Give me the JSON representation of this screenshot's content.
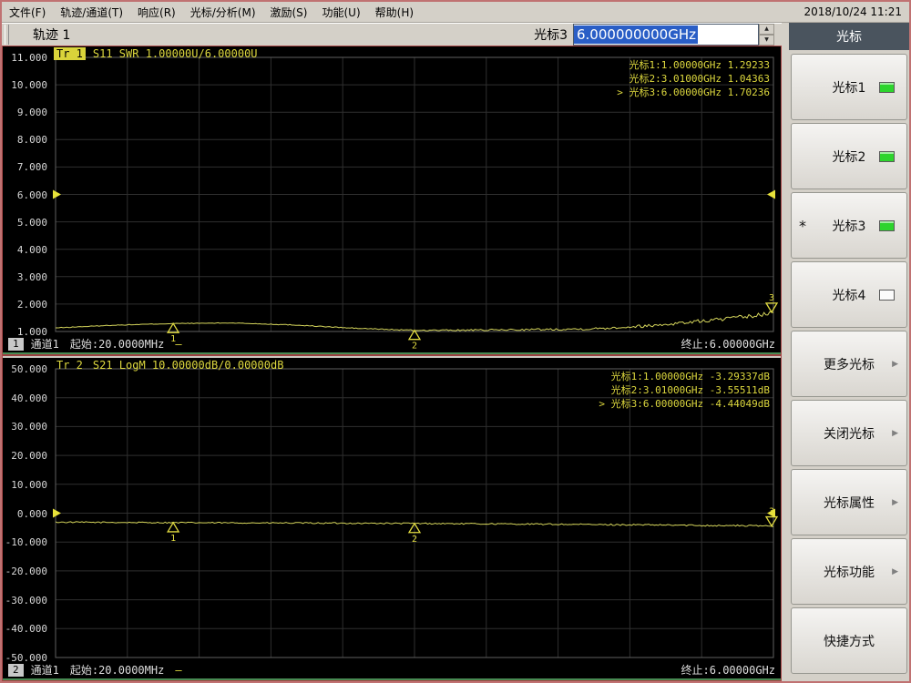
{
  "window": {
    "date_time": "2018/10/24 11:21"
  },
  "menu": {
    "items": [
      {
        "name": "file",
        "label": "文件(F)"
      },
      {
        "name": "trace-channel",
        "label": "轨迹/通道(T)"
      },
      {
        "name": "response",
        "label": "响应(R)"
      },
      {
        "name": "marker-analysis",
        "label": "光标/分析(M)"
      },
      {
        "name": "stimulus",
        "label": "激励(S)"
      },
      {
        "name": "utility",
        "label": "功能(U)"
      },
      {
        "name": "help",
        "label": "帮助(H)"
      }
    ]
  },
  "toolbar": {
    "trace_label": "轨迹 1",
    "marker_field_label": "光标3",
    "marker_field_value": "6.000000000GHz",
    "spin_up": "▲",
    "spin_down": "▼"
  },
  "sidebar": {
    "header": "光标",
    "buttons": [
      {
        "name": "marker1",
        "label": "光标1",
        "led": "on"
      },
      {
        "name": "marker2",
        "label": "光标2",
        "led": "on"
      },
      {
        "name": "marker3",
        "label": "光标3",
        "led": "on",
        "star": "*"
      },
      {
        "name": "marker4",
        "label": "光标4",
        "led": "off"
      },
      {
        "name": "more-markers",
        "label": "更多光标",
        "arrow": true
      },
      {
        "name": "markers-off",
        "label": "关闭光标",
        "arrow": true
      },
      {
        "name": "marker-properties",
        "label": "光标属性",
        "arrow": true
      },
      {
        "name": "marker-function",
        "label": "光标功能",
        "arrow": true
      },
      {
        "name": "shortcuts",
        "label": "快捷方式"
      }
    ]
  },
  "colors": {
    "grid": "#2f2f2f",
    "plot_border": "#5f5f5f",
    "trace": "#d6d65c",
    "marker": "#e2dc40",
    "marker_text": "#ddd83e",
    "ref_arrow": "#e8e23a",
    "axis_text": "#d8d8d8",
    "selection_bg": "#2a5ec6",
    "led_on": "#2dd42d",
    "sidebar_header_bg": "#4a545e",
    "window_border": "#c07272",
    "panel_bottom_line": "#478a52"
  },
  "charts": [
    {
      "tr_tag": "Tr 1",
      "tr_highlight": true,
      "title": "S11 SWR 1.00000U/6.00000U",
      "y_axis": {
        "labels": [
          "11.000",
          "10.000",
          "9.000",
          "8.000",
          "7.000",
          "6.000",
          "5.000",
          "4.000",
          "3.000",
          "2.000",
          "1.000"
        ],
        "min": 1,
        "max": 11,
        "ref_value": 6
      },
      "x_axis": {
        "start_ghz": 0.02,
        "stop_ghz": 6.0,
        "divisions": 10
      },
      "markers": [
        {
          "n": "1",
          "line": "光标1:1.00000GHz 1.29233",
          "freq_ghz": 1.0,
          "value": 1.29233,
          "active": false
        },
        {
          "n": "2",
          "line": "光标2:3.01000GHz 1.04363",
          "freq_ghz": 3.01,
          "value": 1.04363,
          "active": false
        },
        {
          "n": "3",
          "line": "> 光标3:6.00000GHz 1.70236",
          "freq_ghz": 6.0,
          "value": 1.70236,
          "active": true
        }
      ],
      "trace": {
        "anchor_ghz": [
          0.02,
          0.5,
          1.0,
          1.5,
          2.0,
          2.5,
          3.01,
          3.5,
          4.0,
          4.5,
          5.0,
          5.4,
          5.7,
          5.9,
          6.0
        ],
        "anchor_val": [
          1.13,
          1.23,
          1.29,
          1.31,
          1.24,
          1.12,
          1.04,
          1.05,
          1.07,
          1.1,
          1.22,
          1.38,
          1.5,
          1.6,
          1.7
        ],
        "noise": 0.012,
        "noise_end": 0.09,
        "seed": 13
      },
      "status": {
        "badge": "1",
        "channel": "通道1",
        "start": "起始:20.0000MHz",
        "sweep": "—",
        "stop": "终止:6.00000GHz"
      }
    },
    {
      "tr_tag": "Tr 2",
      "tr_highlight": false,
      "title": "S21 LogM 10.00000dB/0.00000dB",
      "y_axis": {
        "labels": [
          "50.000",
          "40.000",
          "30.000",
          "20.000",
          "10.000",
          "0.000",
          "-10.000",
          "-20.000",
          "-30.000",
          "-40.000",
          "-50.000"
        ],
        "min": -50,
        "max": 50,
        "ref_value": 0
      },
      "x_axis": {
        "start_ghz": 0.02,
        "stop_ghz": 6.0,
        "divisions": 10
      },
      "markers": [
        {
          "n": "1",
          "line": "光标1:1.00000GHz -3.29337dB",
          "freq_ghz": 1.0,
          "value": -3.29337,
          "active": false
        },
        {
          "n": "2",
          "line": "光标2:3.01000GHz -3.55511dB",
          "freq_ghz": 3.01,
          "value": -3.55511,
          "active": false
        },
        {
          "n": "3",
          "line": "> 光标3:6.00000GHz -4.44049dB",
          "freq_ghz": 6.0,
          "value": -4.44049,
          "active": true
        }
      ],
      "trace": {
        "anchor_ghz": [
          0.02,
          1.0,
          2.0,
          3.01,
          4.0,
          5.0,
          6.0
        ],
        "anchor_val": [
          -3.12,
          -3.29,
          -3.42,
          -3.56,
          -3.8,
          -4.1,
          -4.44
        ],
        "noise": 0.22,
        "noise_end": 0.3,
        "seed": 97
      },
      "status": {
        "badge": "2",
        "channel": "通道1",
        "start": "起始:20.0000MHz",
        "sweep": "—",
        "stop": "终止:6.00000GHz"
      }
    }
  ]
}
